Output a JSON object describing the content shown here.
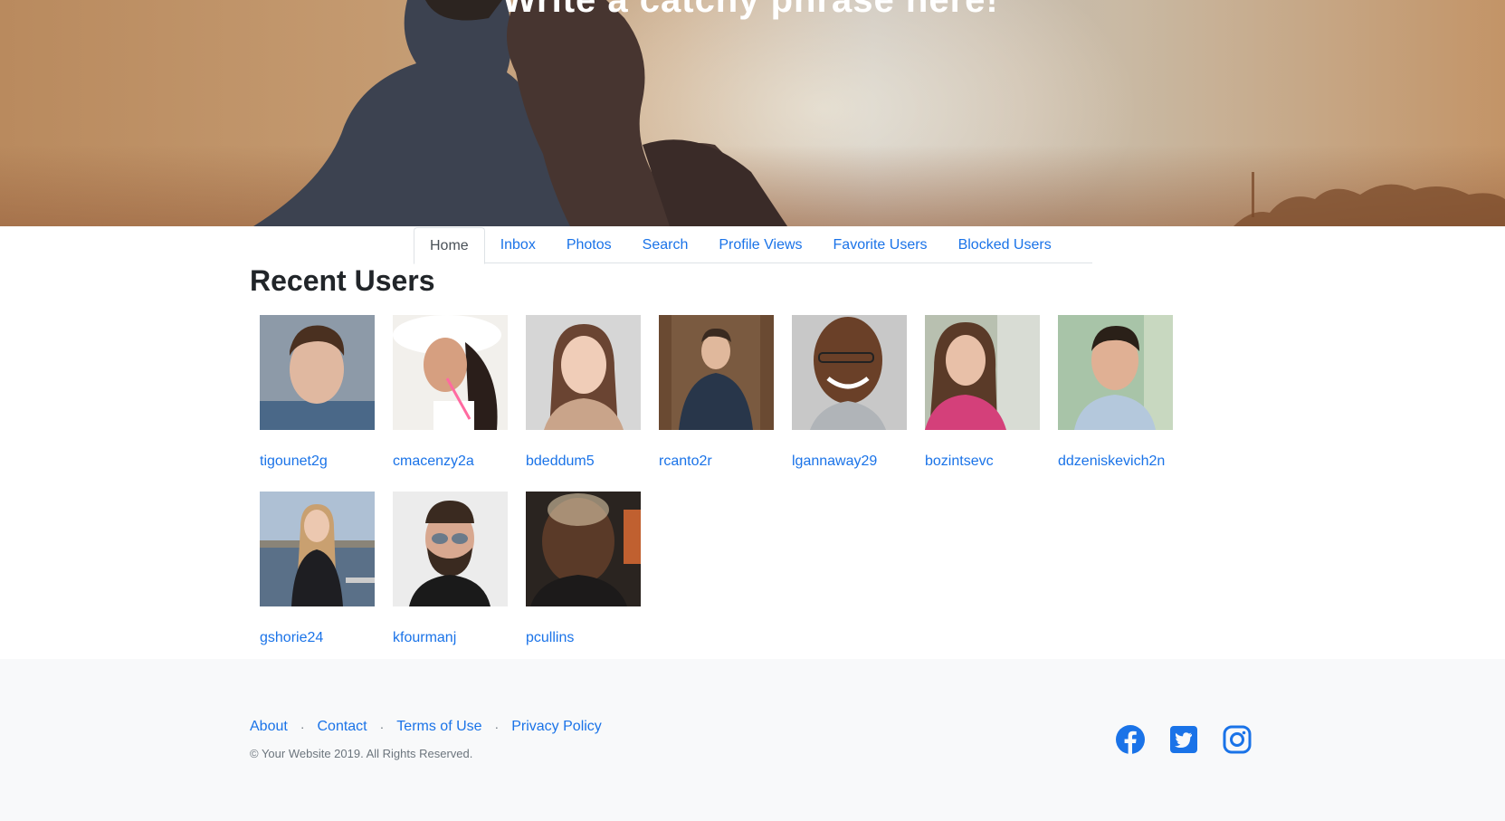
{
  "hero": {
    "title": "Write a catchy phrase here!"
  },
  "tabs": [
    {
      "label": "Home",
      "active": true
    },
    {
      "label": "Inbox",
      "active": false
    },
    {
      "label": "Photos",
      "active": false
    },
    {
      "label": "Search",
      "active": false
    },
    {
      "label": "Profile Views",
      "active": false
    },
    {
      "label": "Favorite Users",
      "active": false
    },
    {
      "label": "Blocked Users",
      "active": false
    }
  ],
  "recent_users": {
    "title": "Recent Users",
    "users": [
      {
        "username": "tigounet2g"
      },
      {
        "username": "cmacenzy2a"
      },
      {
        "username": "bdeddum5"
      },
      {
        "username": "rcanto2r"
      },
      {
        "username": "lgannaway29"
      },
      {
        "username": "bozintsevc"
      },
      {
        "username": "ddzeniskevich2n"
      },
      {
        "username": "gshorie24"
      },
      {
        "username": "kfourmanj"
      },
      {
        "username": "pcullins"
      }
    ]
  },
  "footer": {
    "links": [
      "About",
      "Contact",
      "Terms of Use",
      "Privacy Policy"
    ],
    "copyright": "© Your Website 2019. All Rights Reserved.",
    "social": [
      "facebook-icon",
      "twitter-icon",
      "instagram-icon"
    ]
  },
  "colors": {
    "link": "#1a73e8",
    "footer_bg": "#f8f9fa",
    "facebook": "#1877f2",
    "twitter": "#1a73e8",
    "instagram": "#1a73e8"
  }
}
